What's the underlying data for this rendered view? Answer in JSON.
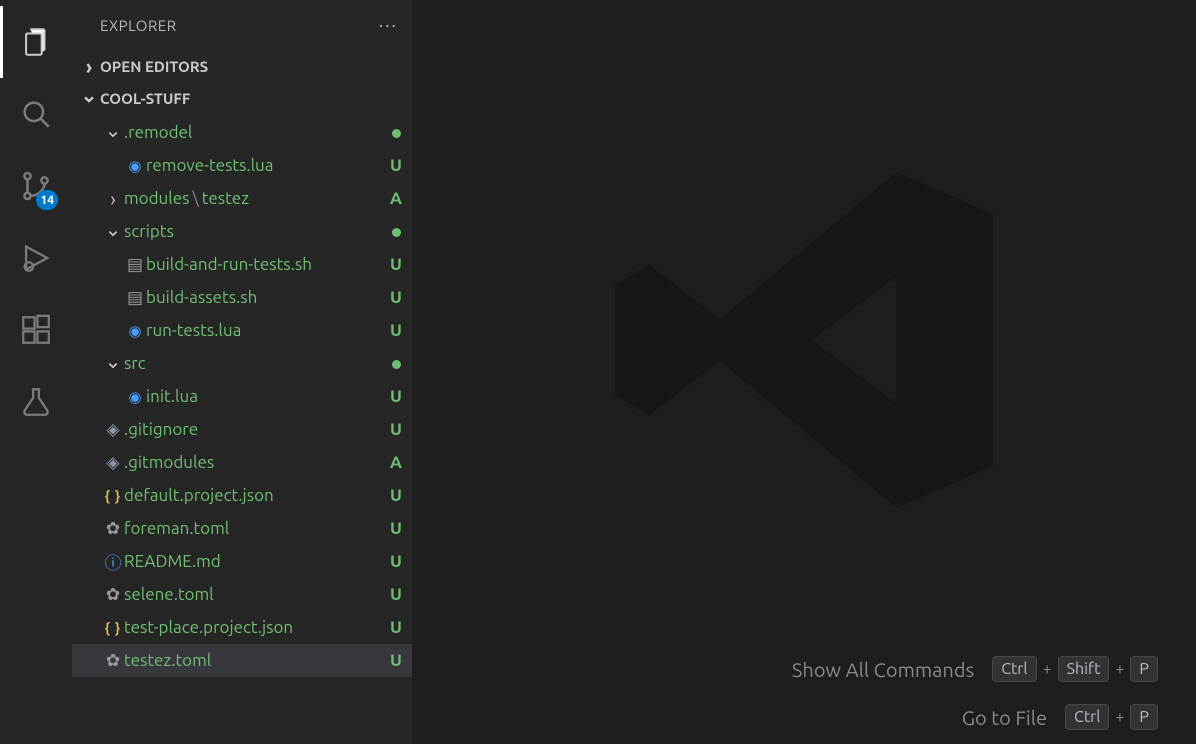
{
  "activity": {
    "items": [
      "explorer",
      "search",
      "source-control",
      "run",
      "extensions",
      "testing"
    ],
    "active": "explorer",
    "scm_badge": "14"
  },
  "explorer": {
    "title": "EXPLORER",
    "more_label": "···",
    "open_editors_label": "OPEN EDITORS",
    "workspace_label": "COOL-STUFF"
  },
  "tree": [
    {
      "kind": "folder",
      "name": ".remodel",
      "expanded": true,
      "indent": 1,
      "git": "dot"
    },
    {
      "kind": "file",
      "name": "remove-tests.lua",
      "icon": "lua",
      "indent": 2,
      "git": "U"
    },
    {
      "kind": "folder",
      "name": "modules",
      "suffix": "testez",
      "expanded": false,
      "indent": 1,
      "git": "A"
    },
    {
      "kind": "folder",
      "name": "scripts",
      "expanded": true,
      "indent": 1,
      "git": "dot"
    },
    {
      "kind": "file",
      "name": "build-and-run-tests.sh",
      "icon": "sh",
      "indent": 2,
      "git": "U"
    },
    {
      "kind": "file",
      "name": "build-assets.sh",
      "icon": "sh",
      "indent": 2,
      "git": "U"
    },
    {
      "kind": "file",
      "name": "run-tests.lua",
      "icon": "lua",
      "indent": 2,
      "git": "U"
    },
    {
      "kind": "folder",
      "name": "src",
      "expanded": true,
      "indent": 1,
      "git": "dot"
    },
    {
      "kind": "file",
      "name": "init.lua",
      "icon": "lua",
      "indent": 2,
      "git": "U"
    },
    {
      "kind": "file",
      "name": ".gitignore",
      "icon": "git",
      "indent": 1,
      "git": "U"
    },
    {
      "kind": "file",
      "name": ".gitmodules",
      "icon": "git",
      "indent": 1,
      "git": "A"
    },
    {
      "kind": "file",
      "name": "default.project.json",
      "icon": "json",
      "indent": 1,
      "git": "U"
    },
    {
      "kind": "file",
      "name": "foreman.toml",
      "icon": "gear",
      "indent": 1,
      "git": "U"
    },
    {
      "kind": "file",
      "name": "README.md",
      "icon": "info",
      "indent": 1,
      "git": "U"
    },
    {
      "kind": "file",
      "name": "selene.toml",
      "icon": "gear",
      "indent": 1,
      "git": "U"
    },
    {
      "kind": "file",
      "name": "test-place.project.json",
      "icon": "json",
      "indent": 1,
      "git": "U"
    },
    {
      "kind": "file",
      "name": "testez.toml",
      "icon": "gear",
      "indent": 1,
      "git": "U",
      "selected": true
    }
  ],
  "welcome": {
    "shortcuts": [
      {
        "label": "Show All Commands",
        "keys": [
          "Ctrl",
          "Shift",
          "P"
        ]
      },
      {
        "label": "Go to File",
        "keys": [
          "Ctrl",
          "P"
        ]
      }
    ]
  }
}
